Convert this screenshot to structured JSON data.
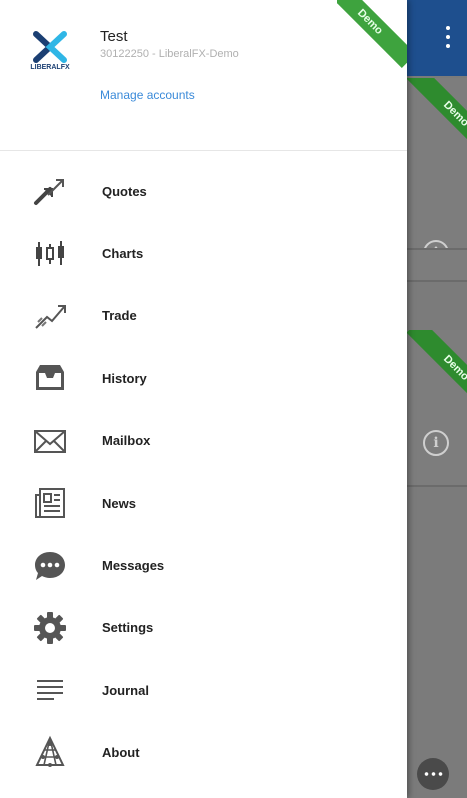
{
  "account": {
    "name": "Test",
    "subtitle": "30122250 - LiberalFX-Demo",
    "manage_link": "Manage accounts",
    "badge": "Demo"
  },
  "brand": {
    "logo_text": "LIBERALFX"
  },
  "menu": [
    {
      "label": "Quotes",
      "icon": "quotes-icon"
    },
    {
      "label": "Charts",
      "icon": "charts-icon"
    },
    {
      "label": "Trade",
      "icon": "trade-icon"
    },
    {
      "label": "History",
      "icon": "history-icon"
    },
    {
      "label": "Mailbox",
      "icon": "mailbox-icon"
    },
    {
      "label": "News",
      "icon": "news-icon"
    },
    {
      "label": "Messages",
      "icon": "messages-icon"
    },
    {
      "label": "Settings",
      "icon": "settings-icon"
    },
    {
      "label": "Journal",
      "icon": "journal-icon"
    },
    {
      "label": "About",
      "icon": "about-icon"
    }
  ],
  "background": {
    "badges": [
      "Demo",
      "Demo",
      "Demo"
    ]
  },
  "colors": {
    "accent": "#3a8ad9",
    "topbar": "#1e4f8e",
    "demo": "#3ea33e"
  }
}
